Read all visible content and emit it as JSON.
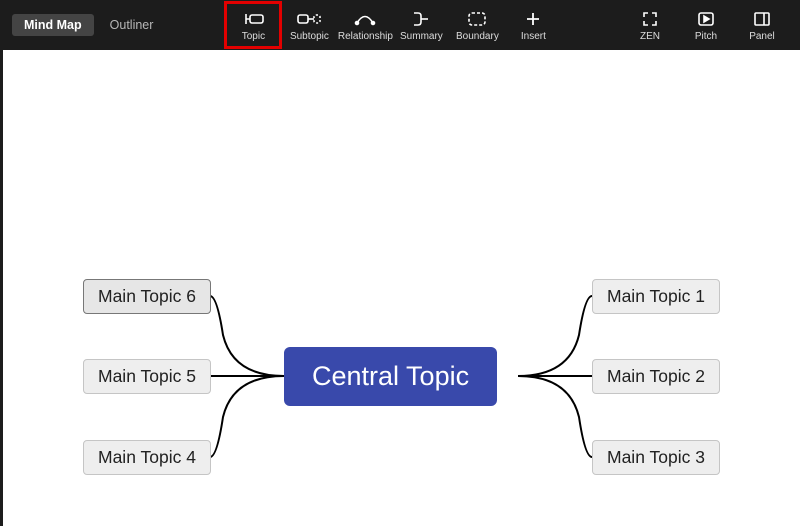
{
  "viewTabs": {
    "mindmap": "Mind Map",
    "outliner": "Outliner"
  },
  "tools": {
    "topic": "Topic",
    "subtopic": "Subtopic",
    "relationship": "Relationship",
    "summary": "Summary",
    "boundary": "Boundary",
    "insert": "Insert",
    "zen": "ZEN",
    "pitch": "Pitch",
    "panel": "Panel"
  },
  "mindmap": {
    "central": "Central Topic",
    "left": [
      "Main Topic 6",
      "Main Topic 5",
      "Main Topic 4"
    ],
    "right": [
      "Main Topic 1",
      "Main Topic 2",
      "Main Topic 3"
    ]
  }
}
